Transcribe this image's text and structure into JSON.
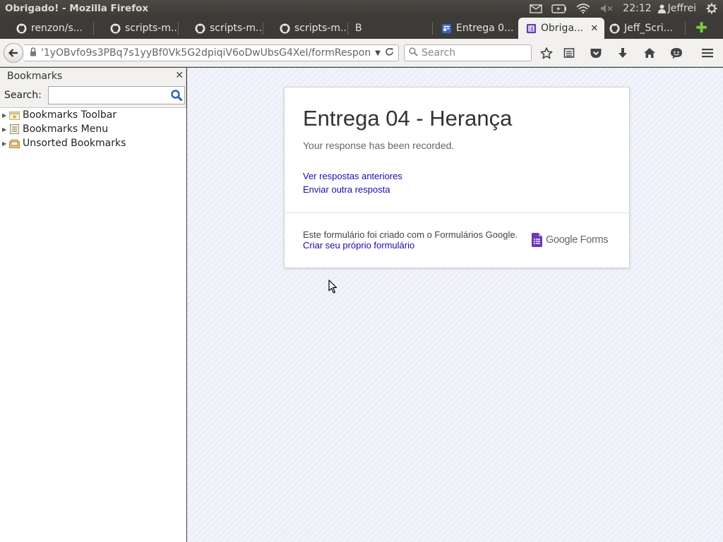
{
  "window": {
    "title": "Obrigado! - Mozilla Firefox"
  },
  "top_panel": {
    "clock": "22:12",
    "user": "Jeffrei",
    "indicators": [
      "mail-icon",
      "battery-icon",
      "wifi-icon",
      "volume-muted-icon"
    ]
  },
  "tabs": [
    {
      "label": "renzon/s...",
      "icon": "github-icon"
    },
    {
      "label": "scripts-m...",
      "icon": "github-icon"
    },
    {
      "label": "scripts-m...",
      "icon": "github-icon"
    },
    {
      "label": "scripts-m...",
      "icon": "github-icon"
    },
    {
      "label": "B",
      "icon": ""
    },
    {
      "label": "Entrega 0...",
      "icon": "google-sites-icon"
    },
    {
      "label": "Obriga...",
      "icon": "google-forms-icon",
      "active": true
    },
    {
      "label": "Jeff_Scri...",
      "icon": "github-icon"
    }
  ],
  "navbar": {
    "url": "'1yOBvfo9s3PBq7s1yyBf0Vk5G2dpiqiV6oDwUbsG4XeI/formResponse",
    "search_placeholder": "Search"
  },
  "sidebar": {
    "title": "Bookmarks",
    "search_label": "Search:",
    "search_value": "",
    "items": [
      {
        "label": "Bookmarks Toolbar"
      },
      {
        "label": "Bookmarks Menu"
      },
      {
        "label": "Unsorted Bookmarks"
      }
    ]
  },
  "form": {
    "title": "Entrega 04 - Herança",
    "message": "Your response has been recorded.",
    "link_previous": "Ver respostas anteriores",
    "link_another": "Enviar outra resposta",
    "footer_text": "Este formulário foi criado com o Formulários Google.",
    "footer_link": "Criar seu próprio formulário",
    "brand": "Google Forms"
  },
  "colors": {
    "link": "#1a0dab",
    "forms_purple": "#673ab7",
    "panel_bg": "#3c3b37",
    "content_bg": "#eceff7"
  }
}
